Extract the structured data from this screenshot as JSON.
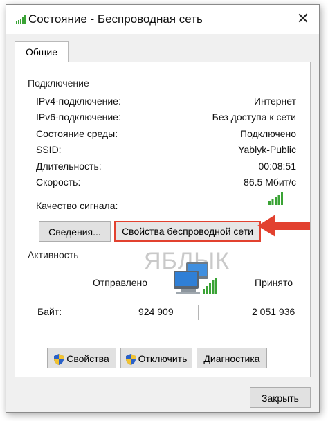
{
  "window": {
    "title": "Состояние - Беспроводная сеть",
    "close_glyph": "✕"
  },
  "tabs": [
    {
      "label": "Общие"
    }
  ],
  "connection": {
    "title": "Подключение",
    "rows": [
      {
        "label": "IPv4-подключение:",
        "value": "Интернет"
      },
      {
        "label": "IPv6-подключение:",
        "value": "Без доступа к сети"
      },
      {
        "label": "Состояние среды:",
        "value": "Подключено"
      },
      {
        "label": "SSID:",
        "value": "Yablyk-Public"
      },
      {
        "label": "Длительность:",
        "value": "00:08:51"
      },
      {
        "label": "Скорость:",
        "value": "86.5 Мбит/с"
      }
    ],
    "signal_label": "Качество сигнала:",
    "signal_level": 5,
    "signal_max": 5,
    "details_button": "Сведения...",
    "wireless_props_button": "Свойства беспроводной сети"
  },
  "watermark": "ЯБЛЫК",
  "activity": {
    "title": "Активность",
    "sent_label": "Отправлено",
    "received_label": "Принято",
    "bytes_label": "Байт:",
    "bytes_sent": "924 909",
    "bytes_received": "2 051 936"
  },
  "buttons": {
    "properties": "Свойства",
    "disable": "Отключить",
    "diagnostics": "Диагностика",
    "close": "Закрыть"
  },
  "colors": {
    "signal_green": "#3aa335",
    "arrow_red": "#e2412f",
    "highlight_border": "#e2412f"
  },
  "icons": {
    "title": "wifi-signal-icon",
    "network": "network-computers-icon",
    "shield": "uac-shield-icon",
    "arrow": "red-arrow-icon"
  }
}
